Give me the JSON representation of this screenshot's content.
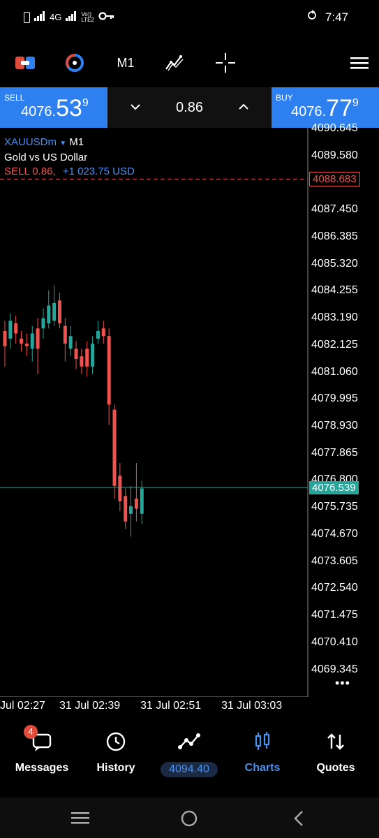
{
  "status_bar": {
    "network_left": "4G",
    "network_right": "LTE2",
    "network_vo": "Vo))",
    "time": "7:47"
  },
  "toolbar": {
    "timeframe": "M1"
  },
  "trade": {
    "sell_label": "SELL",
    "sell_price_small": "4076.",
    "sell_price_big": "53",
    "sell_price_sup": "9",
    "volume": "0.86",
    "buy_label": "BUY",
    "buy_price_small": "4076.",
    "buy_price_big": "77",
    "buy_price_sup": "9"
  },
  "chart_info": {
    "symbol": "XAUUSDm",
    "timeframe": "M1",
    "description": "Gold vs US Dollar",
    "position_side": "SELL 0.86,",
    "position_profit": "+1 023.75 USD"
  },
  "chart_data": {
    "type": "candlestick",
    "price_axis": [
      "4090.645",
      "4089.580",
      "4088.515",
      "4087.450",
      "4086.385",
      "4085.320",
      "4084.255",
      "4083.190",
      "4082.125",
      "4081.060",
      "4079.995",
      "4078.930",
      "4077.865",
      "4076.800",
      "4075.735",
      "4074.670",
      "4073.605",
      "4072.540",
      "4071.475",
      "4070.410",
      "4069.345"
    ],
    "time_axis": [
      "Jul 02:27",
      "31 Jul 02:39",
      "31 Jul 02:51",
      "31 Jul 03:03"
    ],
    "position_line_price": "4088.683",
    "current_price": "4076.539",
    "ylim": [
      4068.8,
      4091.2
    ],
    "candles": [
      {
        "o": 4082.7,
        "c": 4082.1,
        "h": 4083.1,
        "l": 4081.3
      },
      {
        "o": 4082.4,
        "c": 4083.1,
        "h": 4083.4,
        "l": 4082.0
      },
      {
        "o": 4083.0,
        "c": 4082.6,
        "h": 4083.3,
        "l": 4082.2
      },
      {
        "o": 4082.4,
        "c": 4082.2,
        "h": 4082.7,
        "l": 4081.9
      },
      {
        "o": 4082.2,
        "c": 4082.1,
        "h": 4082.6,
        "l": 4081.7
      },
      {
        "o": 4082.0,
        "c": 4082.6,
        "h": 4082.9,
        "l": 4081.5
      },
      {
        "o": 4082.8,
        "c": 4082.0,
        "h": 4083.2,
        "l": 4081.0
      },
      {
        "o": 4082.8,
        "c": 4083.2,
        "h": 4083.6,
        "l": 4082.4
      },
      {
        "o": 4083.0,
        "c": 4083.7,
        "h": 4084.3,
        "l": 4082.8
      },
      {
        "o": 4083.1,
        "c": 4083.8,
        "h": 4084.5,
        "l": 4082.9
      },
      {
        "o": 4083.9,
        "c": 4083.0,
        "h": 4084.2,
        "l": 4082.8
      },
      {
        "o": 4082.9,
        "c": 4082.2,
        "h": 4083.2,
        "l": 4081.5
      },
      {
        "o": 4082.0,
        "c": 4082.5,
        "h": 4082.9,
        "l": 4081.7
      },
      {
        "o": 4082.0,
        "c": 4081.6,
        "h": 4082.3,
        "l": 4081.2
      },
      {
        "o": 4081.7,
        "c": 4081.3,
        "h": 4082.0,
        "l": 4081.0
      },
      {
        "o": 4082.0,
        "c": 4081.3,
        "h": 4082.3,
        "l": 4080.9
      },
      {
        "o": 4081.3,
        "c": 4082.2,
        "h": 4082.5,
        "l": 4081.0
      },
      {
        "o": 4082.4,
        "c": 4082.7,
        "h": 4083.1,
        "l": 4082.2
      },
      {
        "o": 4082.8,
        "c": 4082.5,
        "h": 4083.1,
        "l": 4082.2
      },
      {
        "o": 4082.5,
        "c": 4079.8,
        "h": 4082.8,
        "l": 4079.0
      },
      {
        "o": 4079.6,
        "c": 4076.6,
        "h": 4079.8,
        "l": 4076.1
      },
      {
        "o": 4077.0,
        "c": 4076.0,
        "h": 4077.5,
        "l": 4075.6
      },
      {
        "o": 4076.2,
        "c": 4075.2,
        "h": 4076.5,
        "l": 4074.9
      },
      {
        "o": 4075.5,
        "c": 4075.8,
        "h": 4076.6,
        "l": 4074.6
      },
      {
        "o": 4076.1,
        "c": 4075.7,
        "h": 4077.5,
        "l": 4075.2
      },
      {
        "o": 4075.5,
        "c": 4076.5,
        "h": 4076.8,
        "l": 4075.1
      }
    ]
  },
  "bottom_nav": {
    "messages": "Messages",
    "messages_badge": "4",
    "history": "History",
    "equity": "4094.40",
    "charts": "Charts",
    "quotes": "Quotes"
  },
  "colors": {
    "accent": "#2e7ff0",
    "bull": "#26a69a",
    "bear": "#ef5350",
    "position_line": "#ef5350",
    "price_line": "#26a69a"
  }
}
